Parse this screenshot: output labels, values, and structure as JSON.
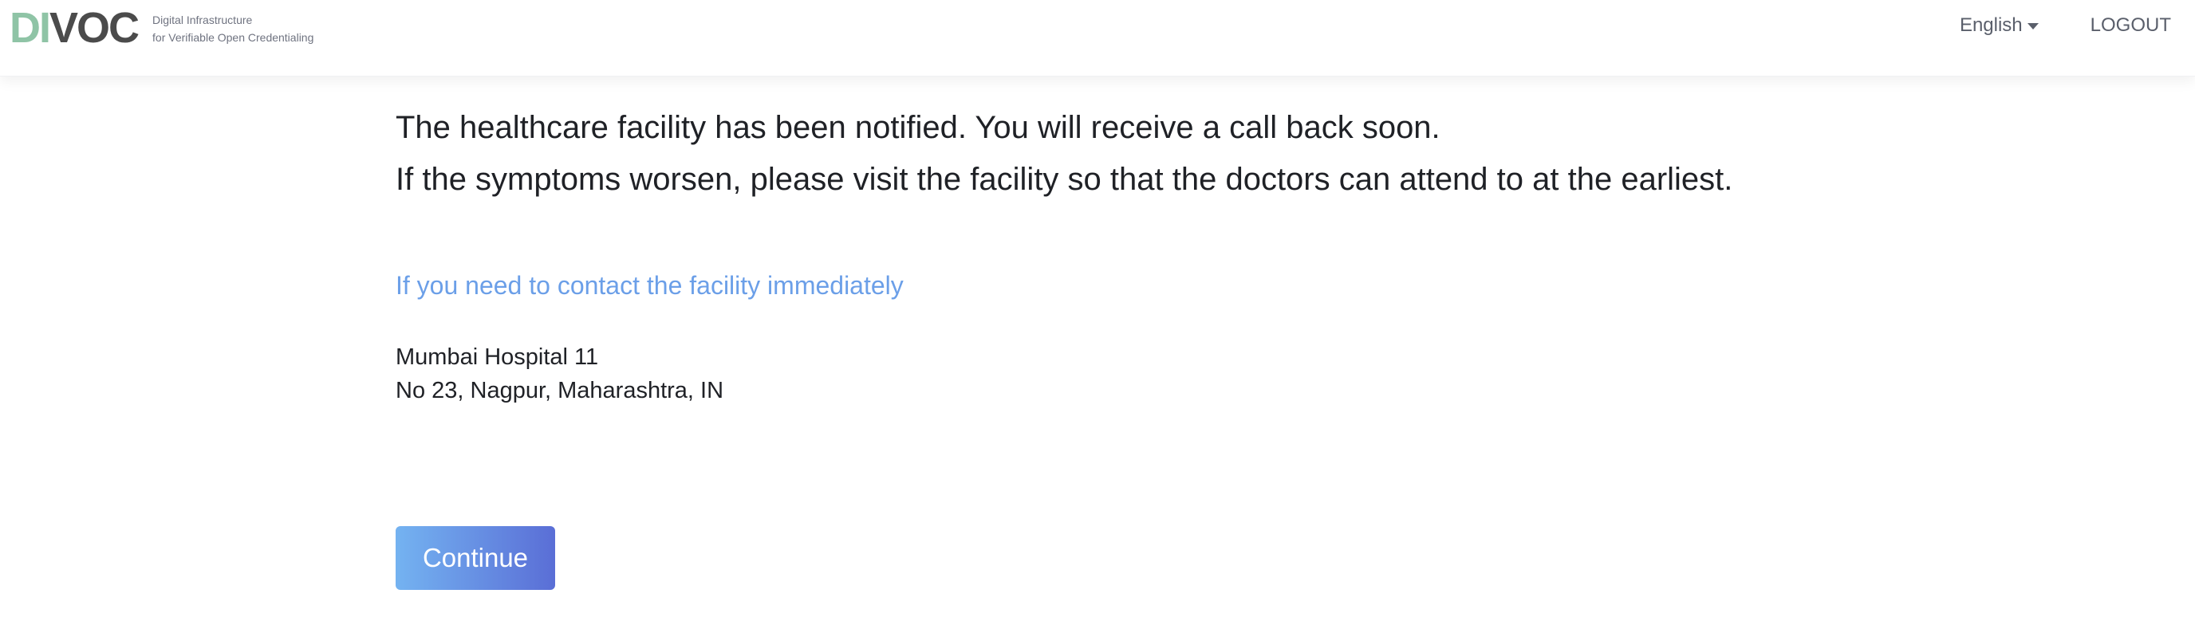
{
  "header": {
    "logo": {
      "text_green": "DI",
      "text_dark": "VOC",
      "tagline_line1": "Digital Infrastructure",
      "tagline_line2": "for Verifiable Open Credentialing"
    },
    "language": "English",
    "logout_label": "LOGOUT"
  },
  "main": {
    "message_line1": "The healthcare facility has been notified. You will receive a call back soon.",
    "message_line2": "If the symptoms worsen, please visit the facility so that the doctors can attend to at the earliest.",
    "contact_heading": "If you need to contact the facility immediately",
    "facility_name": "Mumbai Hospital 11",
    "facility_address": "No 23, Nagpur, Maharashtra, IN",
    "continue_label": "Continue"
  },
  "colors": {
    "accent_link": "#6b9fe8",
    "logo_green": "#8fc4a6",
    "logo_dark": "#4b4b4b",
    "button_gradient_start": "#74b3f1",
    "button_gradient_end": "#5a6ed6"
  },
  "icons": {
    "language_dropdown": "chevron-down-icon"
  }
}
